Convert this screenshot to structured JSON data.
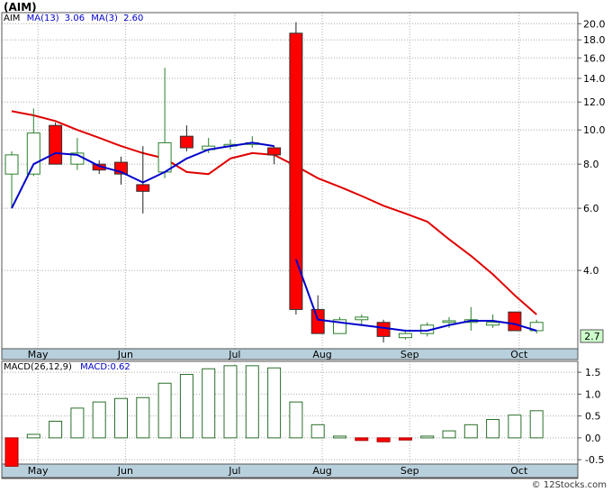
{
  "title": "(AIM)",
  "legend": {
    "ticker": "AIM",
    "ma13_label": "MA(13)",
    "ma13_value": "3.06",
    "ma3_label": "MA(3)",
    "ma3_value": "2.60",
    "macd_label": "MACD(26,12,9)",
    "macd_name": "MACD:",
    "macd_value": "0.62"
  },
  "credit": "© 12Stocks.com",
  "last_price_badge": "2.7",
  "colors": {
    "up": "#2a7f2a",
    "down": "#ff0000",
    "ma13": "#e00000",
    "ma3": "#0000cc",
    "axis_band": "#b8d0dc",
    "macd_bar": "#2a6e2a",
    "badge_bg": "#ccffcc"
  },
  "chart_data": [
    {
      "type": "candlestick",
      "title": "(AIM)",
      "scale": "log",
      "ylim": [
        2.4,
        21.5
      ],
      "y_ticks": [
        4.0,
        6.0,
        8.0,
        10.0,
        12.0,
        14.0,
        16.0,
        18.0,
        20.0
      ],
      "y_tick_labels": [
        "4.0",
        "6.0",
        "8.0",
        "10.0",
        "12.0",
        "14.0",
        "16.0",
        "18.0",
        "20.0"
      ],
      "x_labels": [
        {
          "label": "May",
          "index": 1.2
        },
        {
          "label": "Jun",
          "index": 5.2
        },
        {
          "label": "Jul",
          "index": 10.2
        },
        {
          "label": "Aug",
          "index": 14.2
        },
        {
          "label": "Sep",
          "index": 18.2
        },
        {
          "label": "Oct",
          "index": 23.2
        }
      ],
      "candles": [
        {
          "o": 7.5,
          "h": 8.7,
          "l": 6.0,
          "c": 8.5
        },
        {
          "o": 7.5,
          "h": 11.5,
          "l": 7.4,
          "c": 9.8
        },
        {
          "o": 10.3,
          "h": 10.5,
          "l": 8.0,
          "c": 8.0
        },
        {
          "o": 8.0,
          "h": 9.5,
          "l": 7.7,
          "c": 8.6
        },
        {
          "o": 8.0,
          "h": 8.2,
          "l": 7.5,
          "c": 7.7
        },
        {
          "o": 8.1,
          "h": 8.4,
          "l": 7.0,
          "c": 7.5
        },
        {
          "o": 7.0,
          "h": 9.0,
          "l": 5.8,
          "c": 6.7
        },
        {
          "o": 7.6,
          "h": 15.0,
          "l": 7.3,
          "c": 9.2
        },
        {
          "o": 9.6,
          "h": 10.3,
          "l": 8.7,
          "c": 8.9
        },
        {
          "o": 8.8,
          "h": 9.5,
          "l": 8.6,
          "c": 9.0
        },
        {
          "o": 9.0,
          "h": 9.4,
          "l": 8.8,
          "c": 9.1
        },
        {
          "o": 9.1,
          "h": 9.6,
          "l": 8.9,
          "c": 9.2
        },
        {
          "o": 8.9,
          "h": 9.0,
          "l": 8.0,
          "c": 8.5
        },
        {
          "o": 18.8,
          "h": 20.2,
          "l": 3.0,
          "c": 3.1
        },
        {
          "o": 3.1,
          "h": 3.4,
          "l": 2.8,
          "c": 2.65
        },
        {
          "o": 2.65,
          "h": 2.95,
          "l": 2.65,
          "c": 2.9
        },
        {
          "o": 2.9,
          "h": 3.0,
          "l": 2.8,
          "c": 2.95
        },
        {
          "o": 2.85,
          "h": 2.9,
          "l": 2.5,
          "c": 2.6
        },
        {
          "o": 2.58,
          "h": 2.72,
          "l": 2.55,
          "c": 2.65
        },
        {
          "o": 2.65,
          "h": 2.85,
          "l": 2.6,
          "c": 2.8
        },
        {
          "o": 2.85,
          "h": 2.95,
          "l": 2.75,
          "c": 2.88
        },
        {
          "o": 2.85,
          "h": 3.15,
          "l": 2.7,
          "c": 2.9
        },
        {
          "o": 2.8,
          "h": 3.0,
          "l": 2.75,
          "c": 2.85
        },
        {
          "o": 3.05,
          "h": 3.05,
          "l": 2.7,
          "c": 2.7
        },
        {
          "o": 2.7,
          "h": 2.9,
          "l": 2.65,
          "c": 2.85
        }
      ],
      "series": [
        {
          "name": "MA(13)",
          "x": [
            0,
            1,
            2,
            3,
            4,
            5,
            6,
            7,
            8,
            9,
            10,
            11,
            12,
            13,
            14,
            15,
            16,
            17,
            18,
            19,
            20,
            21,
            22,
            23,
            24
          ],
          "values": [
            11.3,
            11.0,
            10.6,
            10.0,
            9.5,
            9.0,
            8.6,
            8.3,
            7.6,
            7.5,
            8.3,
            8.6,
            8.5,
            7.9,
            7.3,
            6.9,
            6.5,
            6.1,
            5.8,
            5.5,
            4.9,
            4.4,
            3.9,
            3.4,
            3.0
          ]
        },
        {
          "name": "MA(3)",
          "x": [
            0,
            1,
            2,
            3,
            4,
            5,
            6,
            7,
            8,
            9,
            10,
            11,
            12
          ],
          "values": [
            6.0,
            8.0,
            8.6,
            8.5,
            7.9,
            7.6,
            7.1,
            7.6,
            8.3,
            8.8,
            9.0,
            9.2,
            9.0
          ]
        },
        {
          "name": "MA(3) tail",
          "x": [
            13,
            14,
            15,
            16,
            17,
            18,
            19,
            20,
            21,
            22,
            23,
            24
          ],
          "values": [
            4.3,
            2.9,
            2.85,
            2.8,
            2.75,
            2.7,
            2.7,
            2.8,
            2.88,
            2.88,
            2.82,
            2.7
          ]
        }
      ],
      "last_value": 2.7
    },
    {
      "type": "bar",
      "title": "MACD(26,12,9)",
      "ylim": [
        -0.6,
        1.75
      ],
      "y_ticks": [
        -0.5,
        0.0,
        0.5,
        1.0,
        1.5
      ],
      "y_tick_labels": [
        "-0.5",
        "0.0",
        "0.5",
        "1.0",
        "1.5"
      ],
      "x_labels": [
        "May",
        "Jun",
        "Jul",
        "Aug",
        "Sep",
        "Oct"
      ],
      "values": [
        -0.65,
        0.08,
        0.38,
        0.68,
        0.82,
        0.9,
        0.92,
        1.25,
        1.45,
        1.58,
        1.65,
        1.65,
        1.6,
        0.82,
        0.3,
        0.04,
        -0.06,
        -0.09,
        -0.05,
        0.04,
        0.16,
        0.3,
        0.42,
        0.52,
        0.62
      ]
    }
  ]
}
